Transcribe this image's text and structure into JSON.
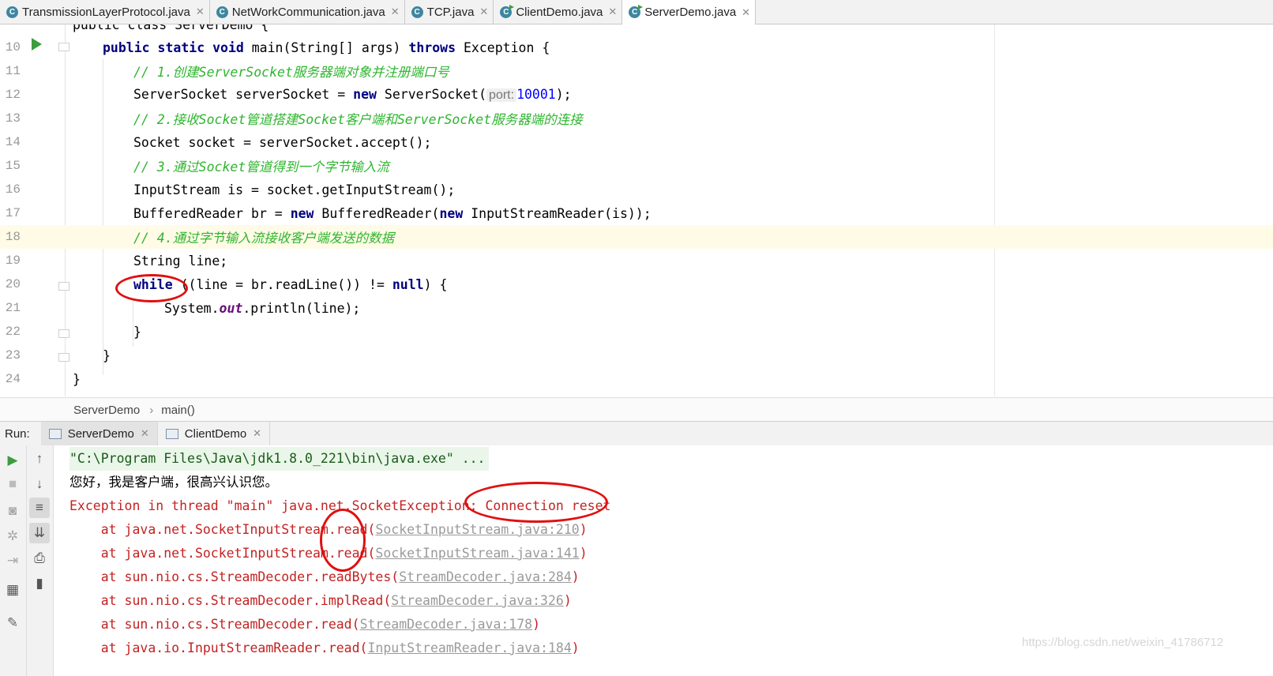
{
  "tabs": [
    {
      "label": "TransmissionLayerProtocol.java",
      "active": false
    },
    {
      "label": "NetWorkCommunication.java",
      "active": false
    },
    {
      "label": "TCP.java",
      "active": false
    },
    {
      "label": "ClientDemo.java",
      "active": false
    },
    {
      "label": "ServerDemo.java",
      "active": true
    }
  ],
  "editor": {
    "partial_top_line": "public class ServerDemo {",
    "line_numbers": [
      "10",
      "11",
      "12",
      "13",
      "14",
      "15",
      "16",
      "17",
      "18",
      "19",
      "20",
      "21",
      "22",
      "23",
      "24"
    ],
    "lines": {
      "l10": {
        "kw1": "public static void",
        "t1": " main(String[] args) ",
        "kw2": "throws",
        "t2": " Exception {"
      },
      "l11": {
        "comment": "// 1.创建ServerSocket服务器端对象并注册端口号"
      },
      "l12": {
        "t1": "ServerSocket serverSocket = ",
        "kw1": "new",
        "t2": " ServerSocket(",
        "hint": "port:",
        "num": "10001",
        "t3": ");"
      },
      "l13": {
        "comment": "// 2.接收Socket管道搭建Socket客户端和ServerSocket服务器端的连接"
      },
      "l14": {
        "t1": "Socket socket = serverSocket.accept();"
      },
      "l15": {
        "comment": "// 3.通过Socket管道得到一个字节输入流"
      },
      "l16": {
        "t1": "InputStream is = socket.getInputStream();"
      },
      "l17": {
        "t1": "BufferedReader br = ",
        "kw1": "new",
        "t2": " BufferedReader(",
        "kw2": "new",
        "t3": " InputStreamReader(is));"
      },
      "l18": {
        "comment": "// 4.通过字节输入流接收客户端发送的数据"
      },
      "l19": {
        "t1": "String line;"
      },
      "l20": {
        "kw1": "while",
        "t1": " ((line = br.readLine()) != ",
        "kw2": "null",
        "t2": ") {"
      },
      "l21": {
        "t1": "System.",
        "field": "out",
        "t2": ".println(line);"
      },
      "l22": {
        "t1": "}"
      },
      "l23": {
        "t1": "}"
      },
      "l24": {
        "t1": "}"
      }
    }
  },
  "breadcrumb": {
    "class": "ServerDemo",
    "method": "main()"
  },
  "run": {
    "label": "Run:",
    "tabs": [
      {
        "label": "ServerDemo",
        "active": true
      },
      {
        "label": "ClientDemo",
        "active": false
      }
    ]
  },
  "console": {
    "cmd": "\"C:\\Program Files\\Java\\jdk1.8.0_221\\bin\\java.exe\" ...",
    "out": "您好，我是客户端，很高兴认识您。",
    "err": "Exception in thread \"main\" java.net.SocketException: Connection reset",
    "stack": [
      {
        "at": "    at java.net.SocketInputStream.read(",
        "link": "SocketInputStream.java:210",
        "end": ")"
      },
      {
        "at": "    at java.net.SocketInputStream.read(",
        "link": "SocketInputStream.java:141",
        "end": ")"
      },
      {
        "at": "    at sun.nio.cs.StreamDecoder.readBytes(",
        "link": "StreamDecoder.java:284",
        "end": ")"
      },
      {
        "at": "    at sun.nio.cs.StreamDecoder.implRead(",
        "link": "StreamDecoder.java:326",
        "end": ")"
      },
      {
        "at": "    at sun.nio.cs.StreamDecoder.read(",
        "link": "StreamDecoder.java:178",
        "end": ")"
      },
      {
        "at": "    at java.io.InputStreamReader.read(",
        "link": "InputStreamReader.java:184",
        "end": ")"
      }
    ]
  },
  "watermark": "https://blog.csdn.net/weixin_41786712",
  "colors": {
    "annotation": "#e01010",
    "comment": "#2fb52f",
    "keyword": "#000080",
    "error": "#c32222"
  }
}
